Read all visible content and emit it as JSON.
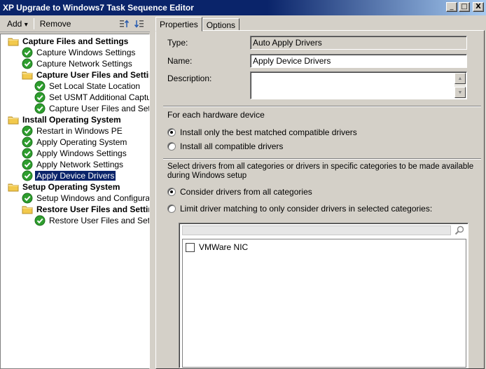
{
  "window": {
    "title": "XP Upgrade to Windows7 Task Sequence Editor",
    "minimize_glyph": "_",
    "maximize_glyph": "□",
    "close_glyph": "X"
  },
  "toolbar": {
    "add_label": "Add",
    "add_arrow": "▾",
    "remove_label": "Remove",
    "move_up_icon": "move-up-icon",
    "move_down_icon": "move-down-icon"
  },
  "tree": {
    "items": [
      {
        "label": "Capture Files and Settings",
        "kind": "group"
      },
      {
        "label": "Capture Windows Settings",
        "kind": "step"
      },
      {
        "label": "Capture Network Settings",
        "kind": "step"
      },
      {
        "label": "Capture User Files and Settings",
        "kind": "group"
      },
      {
        "label": "Set Local State Location",
        "kind": "step"
      },
      {
        "label": "Set USMT Additional Capture Options",
        "kind": "step"
      },
      {
        "label": "Capture User Files and Settings",
        "kind": "step"
      },
      {
        "label": "Install Operating System",
        "kind": "group"
      },
      {
        "label": "Restart in Windows PE",
        "kind": "step"
      },
      {
        "label": "Apply Operating System",
        "kind": "step"
      },
      {
        "label": "Apply Windows Settings",
        "kind": "step"
      },
      {
        "label": "Apply Network Settings",
        "kind": "step"
      },
      {
        "label": "Apply Device Drivers",
        "kind": "step",
        "selected": true
      },
      {
        "label": "Setup Operating System",
        "kind": "group"
      },
      {
        "label": "Setup Windows and Configuration Manager",
        "kind": "step"
      },
      {
        "label": "Restore User Files and Settings",
        "kind": "group"
      },
      {
        "label": "Restore User Files and Settings",
        "kind": "step"
      }
    ]
  },
  "tabs": [
    {
      "label": "Properties",
      "active": true
    },
    {
      "label": "Options",
      "active": false
    }
  ],
  "properties": {
    "type_label": "Type:",
    "type_value": "Auto Apply Drivers",
    "name_label": "Name:",
    "name_value": "Apply Device Drivers",
    "description_label": "Description:",
    "description_value": "",
    "hardware_heading": "For each hardware device",
    "radio_best": "Install only the best matched compatible drivers",
    "radio_all": "Install all compatible drivers",
    "categories_heading_line1": "Select drivers from all categories or drivers in specific categories to be made available",
    "categories_heading_line2": "during Windows setup",
    "radio_consider_all": "Consider drivers from all categories",
    "radio_limit": "Limit driver matching to only consider drivers in selected categories:",
    "search_placeholder": "",
    "categories": [
      {
        "label": "VMWare NIC",
        "checked": false
      }
    ]
  },
  "colors": {
    "selection": "#0a246a",
    "check_green": "#2e9e2e",
    "folder_yellow": "#f2c94c"
  }
}
